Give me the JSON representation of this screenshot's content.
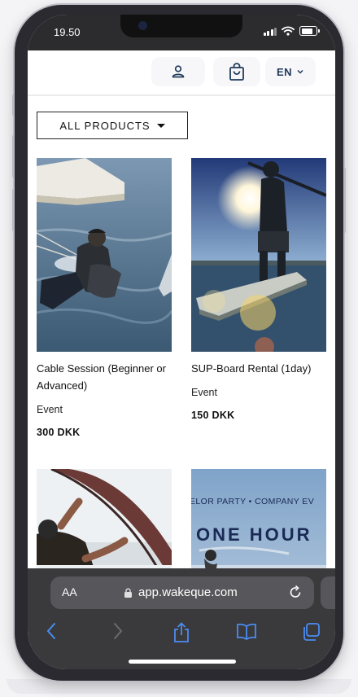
{
  "status_bar": {
    "time": "19.50"
  },
  "header": {
    "language": "EN"
  },
  "filter": {
    "label": "ALL PRODUCTS"
  },
  "products": [
    {
      "title": "Cable Session (Beginner or Advanced)",
      "type": "Event",
      "price": "300 DKK"
    },
    {
      "title": "SUP-Board Rental (1day)",
      "type": "Event",
      "price": "150 DKK"
    },
    {
      "title": "",
      "type": "",
      "price": ""
    },
    {
      "title": "",
      "type": "",
      "price": ""
    }
  ],
  "promo_image_text": {
    "line1": "ELOR PARTY • COMPANY EV",
    "line2": "ONE HOUR"
  },
  "browser": {
    "aa_label": "AA",
    "url": "app.wakeque.com"
  },
  "colors": {
    "accent": "#1f3a5a",
    "browser_chrome": "#3a3a3d",
    "safari_blue": "#4a8cf0"
  }
}
